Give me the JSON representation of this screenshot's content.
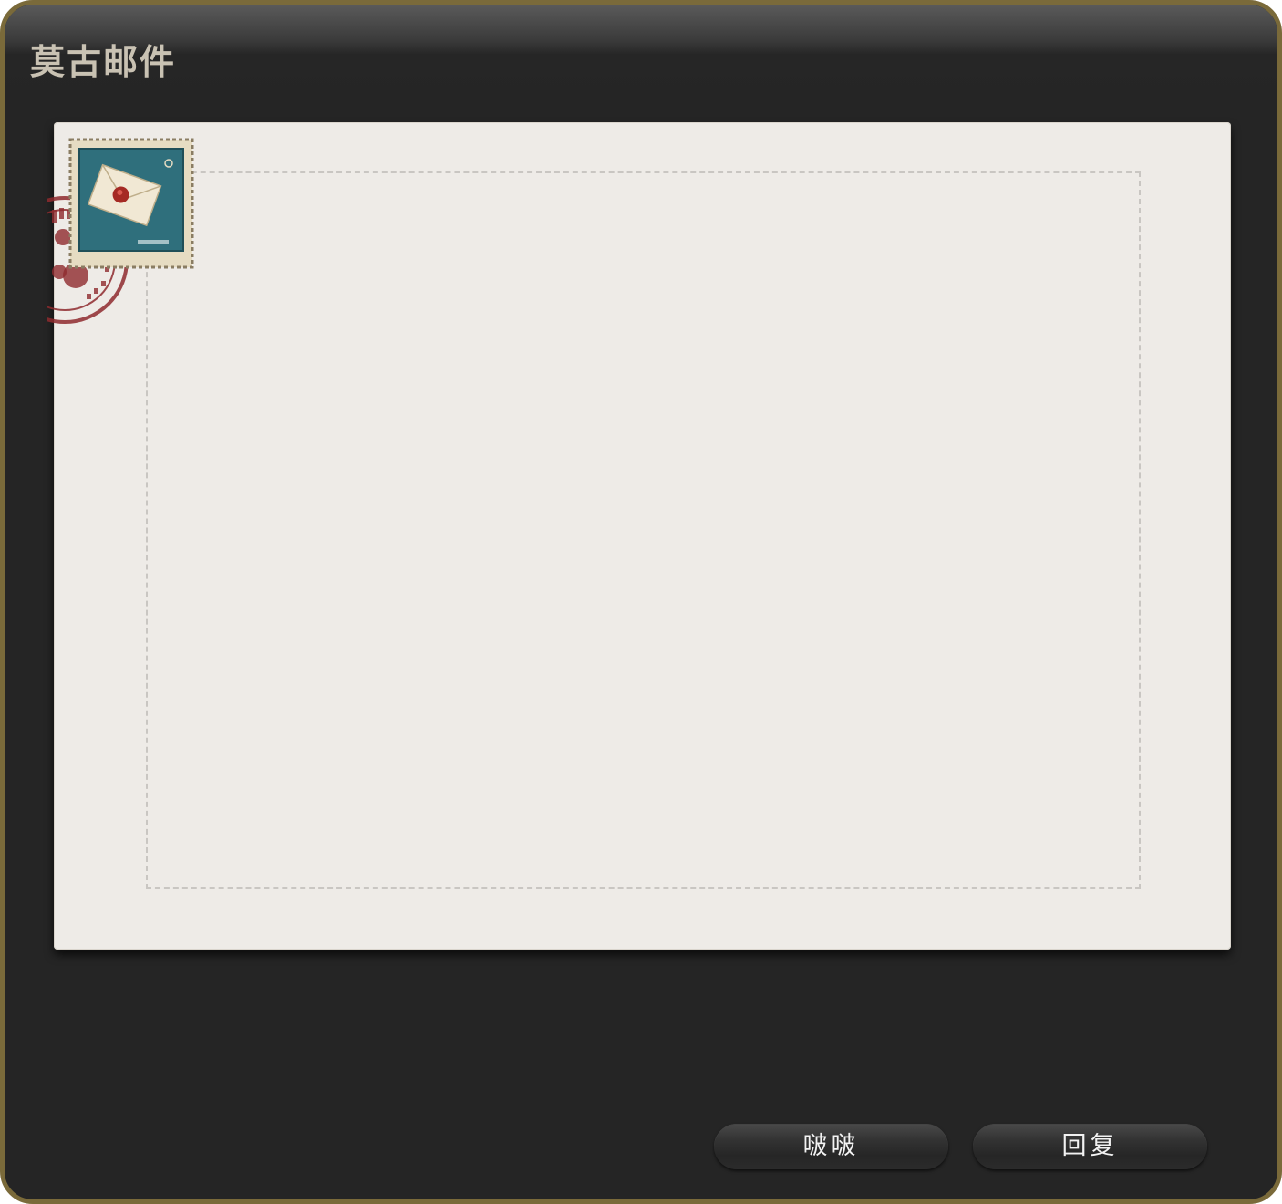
{
  "window": {
    "title": "莫古邮件"
  },
  "letter": {
    "stamp_icon": "envelope-stamp-icon",
    "postmark_icon": "postmark-icon"
  },
  "buttons": {
    "left_label": "啵啵",
    "right_label": "回复"
  },
  "colors": {
    "frame_border": "#7a6a3a",
    "window_bg": "#252525",
    "letter_bg": "#eeebe7",
    "title_text": "#c9c2b3"
  }
}
